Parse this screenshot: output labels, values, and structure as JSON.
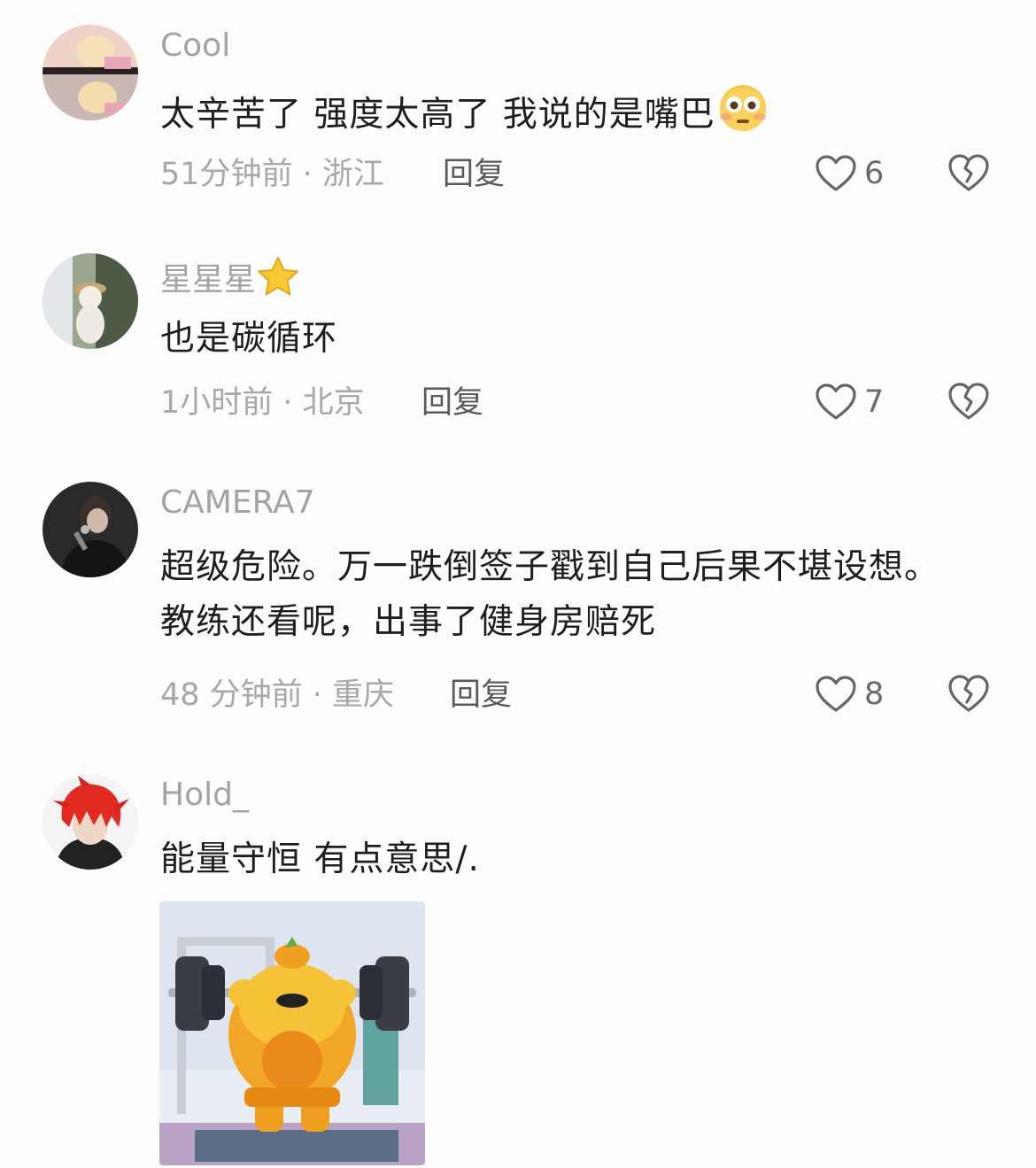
{
  "comments": [
    {
      "username": "Cool",
      "text": "太辛苦了 强度太高了 我说的是嘴巴",
      "emoji": "flushed-face",
      "time_location": "51分钟前 · 浙江",
      "reply_label": "回复",
      "likes": "6"
    },
    {
      "username": "星星星",
      "username_emoji": "star",
      "text": "也是碳循环",
      "time_location": "1小时前 · 北京",
      "reply_label": "回复",
      "likes": "7"
    },
    {
      "username": "CAMERA7",
      "text": "超级危险。万一跌倒签子戳到自己后果不堪设想。教练还看呢，出事了健身房赔死",
      "time_location": "48 分钟前 · 重庆",
      "reply_label": "回复",
      "likes": "8"
    },
    {
      "username": "Hold_",
      "text": "能量守恒 有点意思/.",
      "attachment": "weightlifting-cartoon-sticker"
    }
  ]
}
